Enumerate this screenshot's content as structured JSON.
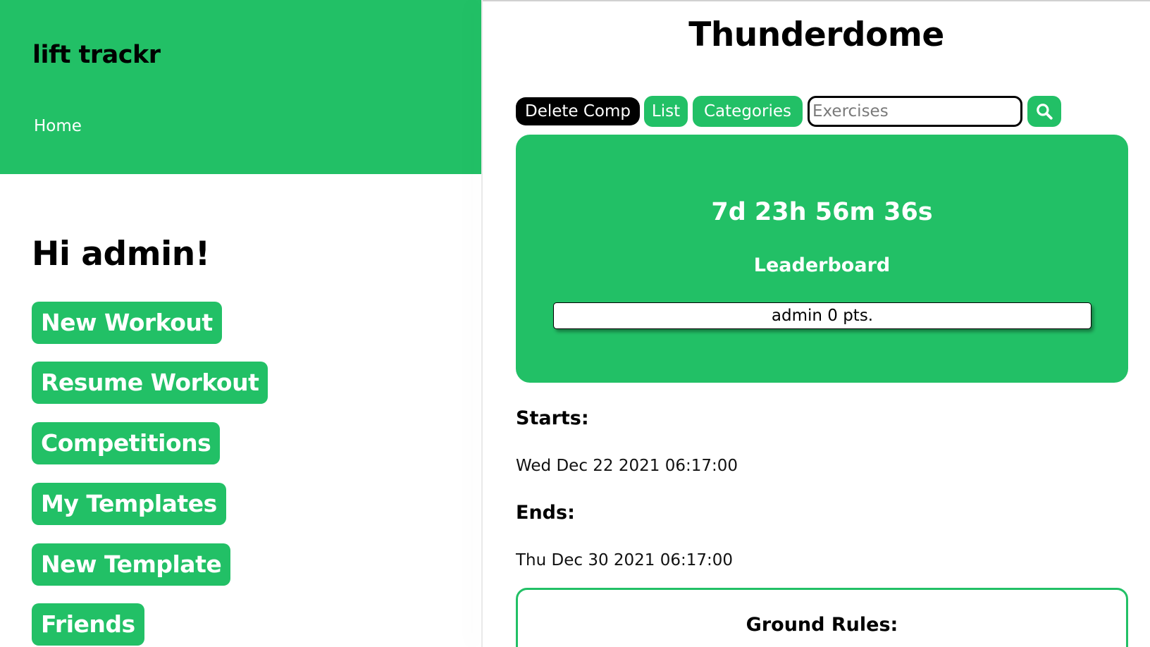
{
  "app": {
    "brand": "lift trackr",
    "nav": {
      "home_label": "Home"
    },
    "greeting": "Hi admin!",
    "menu": [
      "New Workout",
      "Resume Workout",
      "Competitions",
      "My Templates",
      "New Template",
      "Friends"
    ]
  },
  "competition": {
    "title": "Thunderdome",
    "toolbar": {
      "delete_label": "Delete Comp",
      "list_label": "List",
      "categories_label": "Categories",
      "search_placeholder": "Exercises",
      "search_value": "",
      "search_icon": "search-icon"
    },
    "countdown": "7d 23h 56m 36s",
    "leaderboard": {
      "title": "Leaderboard",
      "entries": [
        "admin 0 pts."
      ]
    },
    "starts_label": "Starts:",
    "starts_value": "Wed Dec 22 2021 06:17:00",
    "ends_label": "Ends:",
    "ends_value": "Thu Dec 30 2021 06:17:00",
    "rules_title": "Ground Rules:"
  },
  "colors": {
    "accent": "#22c066",
    "text": "#000000",
    "button_dark": "#000000"
  }
}
